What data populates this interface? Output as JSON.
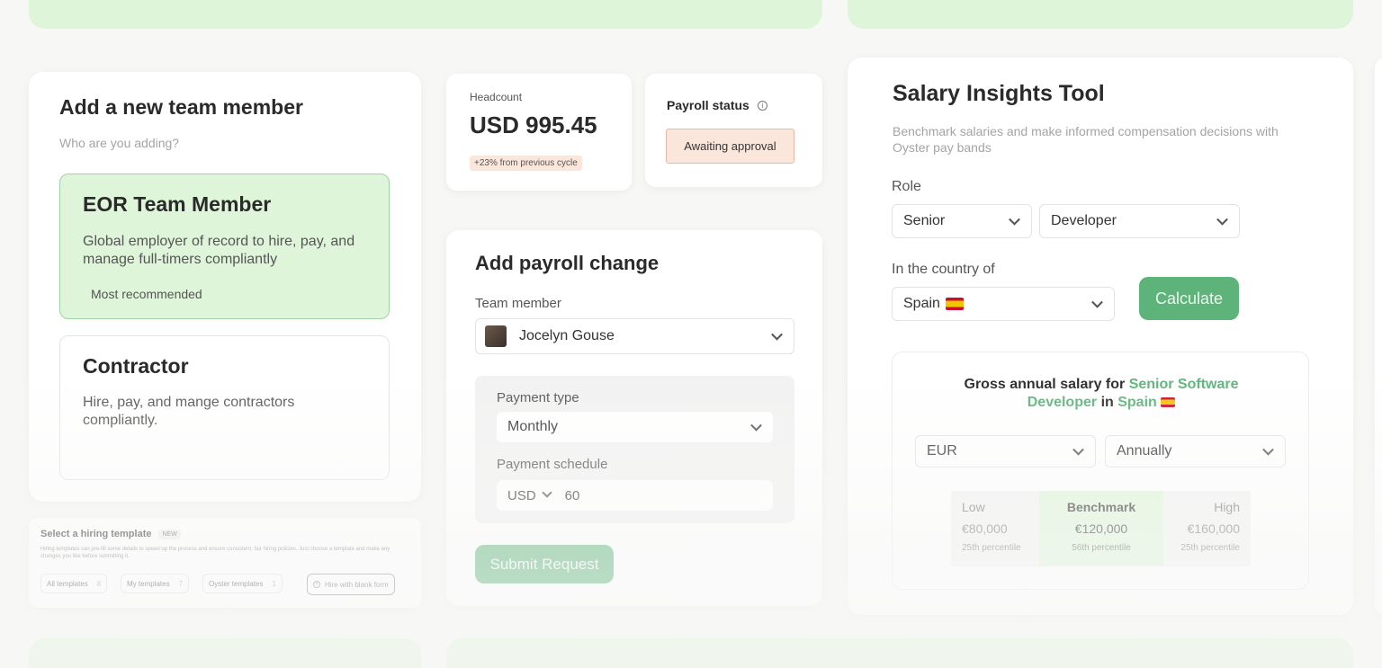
{
  "colors": {
    "accent_green": "#5db379",
    "light_green": "#dff5d9",
    "badge_peach": "#fbe6dc"
  },
  "add_member": {
    "title": "Add a new team member",
    "subtitle": "Who are you adding?",
    "eor": {
      "title": "EOR Team Member",
      "description": "Global employer of record to hire, pay, and manage full-timers compliantly",
      "tag": "Most recommended"
    },
    "contractor": {
      "title": "Contractor",
      "description": "Hire, pay, and mange contractors compliantly."
    }
  },
  "hiring_template": {
    "title": "Select a hiring template",
    "badge": "NEW",
    "description": "Hiring templates can pre-fill some details to speed up the process and ensure consistent, fair hiring policies. Just choose a template and make any changes you like before submitting it.",
    "tabs": [
      {
        "label": "All templates",
        "count": "8"
      },
      {
        "label": "My templates",
        "count": "7"
      },
      {
        "label": "Oyster templates",
        "count": "1"
      }
    ],
    "blank_button": "Hire with blank form"
  },
  "headcount": {
    "label": "Headcount",
    "value": "USD 995.45",
    "change": "+23% from previous cycle"
  },
  "payroll_status": {
    "label": "Payroll status",
    "status": "Awaiting approval",
    "info_icon": "info-icon"
  },
  "payroll_change": {
    "title": "Add payroll change",
    "team_member_label": "Team member",
    "team_member_value": "Jocelyn Gouse",
    "payment_type_label": "Payment type",
    "payment_type_value": "Monthly",
    "payment_schedule_label": "Payment schedule",
    "currency": "USD",
    "schedule_value": "60",
    "submit": "Submit Request"
  },
  "salary_tool": {
    "title": "Salary Insights Tool",
    "description": "Benchmark salaries and make informed compensation decisions with Oyster pay bands",
    "role_label": "Role",
    "level": "Senior",
    "role": "Developer",
    "country_label": "In the country of",
    "country": "Spain",
    "flag": "🇪🇸",
    "calculate": "Calculate",
    "result": {
      "prefix": "Gross annual salary for",
      "role_highlight": "Senior Software Developer",
      "in": "in",
      "country_highlight": "Spain",
      "currency": "EUR",
      "period": "Annually",
      "bands": [
        {
          "label": "Low",
          "value": "€80,000",
          "percentile": "25th percentile"
        },
        {
          "label": "Benchmark",
          "value": "€120,000",
          "percentile": "56th percentile"
        },
        {
          "label": "High",
          "value": "€160,000",
          "percentile": "25th percentile"
        }
      ]
    }
  }
}
